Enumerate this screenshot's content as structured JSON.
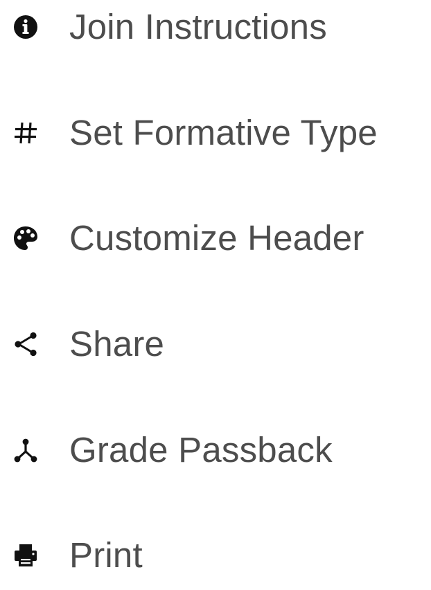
{
  "menu": {
    "items": [
      {
        "label": "Join Instructions",
        "icon": "info-circle-icon"
      },
      {
        "label": "Set Formative Type",
        "icon": "hash-icon"
      },
      {
        "label": "Customize Header",
        "icon": "palette-icon"
      },
      {
        "label": "Share",
        "icon": "share-icon"
      },
      {
        "label": "Grade Passback",
        "icon": "grade-passback-icon"
      },
      {
        "label": "Print",
        "icon": "printer-icon"
      }
    ]
  },
  "colors": {
    "text": "#4d4d4d",
    "icon": "#111111",
    "background": "#ffffff"
  }
}
